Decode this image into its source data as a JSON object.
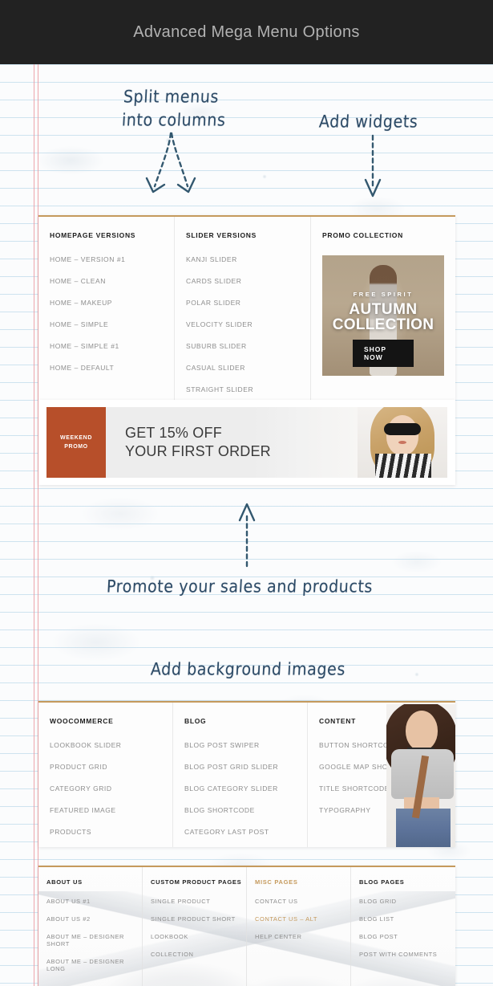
{
  "header": {
    "title": "Advanced Mega Menu Options"
  },
  "annotations": {
    "split_menus_line1": "Split menus",
    "split_menus_line2": "into columns",
    "add_widgets": "Add widgets",
    "promote_sales": "Promote your sales and products",
    "add_background": "Add background images"
  },
  "menu_panel_1": {
    "columns": [
      {
        "title": "HOMEPAGE VERSIONS",
        "items": [
          "HOME – VERSION #1",
          "HOME – CLEAN",
          "HOME – MAKEUP",
          "HOME – SIMPLE",
          "HOME – SIMPLE #1",
          "HOME – DEFAULT"
        ]
      },
      {
        "title": "SLIDER VERSIONS",
        "items": [
          "KANJI SLIDER",
          "CARDS SLIDER",
          "POLAR SLIDER",
          "VELOCITY SLIDER",
          "SUBURB SLIDER",
          "CASUAL SLIDER",
          "STRAIGHT SLIDER"
        ]
      },
      {
        "title": "PROMO COLLECTION",
        "items": []
      }
    ],
    "promo_widget": {
      "kicker": "FREE SPIRIT",
      "headline_line1": "AUTUMN",
      "headline_line2": "COLLECTION",
      "button": "SHOP NOW"
    }
  },
  "banner": {
    "tag_line1": "WEEKEND",
    "tag_line2": "PROMO",
    "headline_line1": "GET 15% OFF",
    "headline_line2": "YOUR FIRST ORDER",
    "tag_color": "#b74f2a"
  },
  "menu_panel_2": {
    "columns": [
      {
        "title": "WOOCOMMERCE",
        "items": [
          "LOOKBOOK SLIDER",
          "PRODUCT GRID",
          "CATEGORY GRID",
          "FEATURED IMAGE",
          "PRODUCTS"
        ]
      },
      {
        "title": "BLOG",
        "items": [
          "BLOG POST SWIPER",
          "BLOG POST GRID SLIDER",
          "BLOG CATEGORY SLIDER",
          "BLOG SHORTCODE",
          "CATEGORY LAST POST"
        ]
      },
      {
        "title": "CONTENT",
        "items": [
          "BUTTON SHORTCODE",
          "GOOGLE MAP SHORTCODE",
          "TITLE SHORTCODE",
          "TYPOGRAPHY"
        ]
      }
    ]
  },
  "menu_panel_3": {
    "columns": [
      {
        "title": "ABOUT US",
        "items": [
          "ABOUT US #1",
          "ABOUT US #2",
          "ABOUT ME – DESIGNER SHORT",
          "ABOUT ME – DESIGNER LONG"
        ]
      },
      {
        "title": "CUSTOM PRODUCT PAGES",
        "items": [
          "SINGLE PRODUCT",
          "SINGLE PRODUCT SHORT",
          "LOOKBOOK",
          "COLLECTION"
        ]
      },
      {
        "title": "MISC PAGES",
        "items": [
          "CONTACT US",
          "CONTACT US – ALT",
          "HELP CENTER"
        ]
      },
      {
        "title": "BLOG PAGES",
        "items": [
          "BLOG GRID",
          "BLOG LIST",
          "BLOG POST",
          "POST WITH COMMENTS"
        ]
      }
    ]
  },
  "colors": {
    "accent_gold": "#c59a5d",
    "header_bg": "#222222",
    "header_text": "#b2b2b2",
    "link_gray": "#8d8d8d",
    "handwriting_blue": "#2c4a66"
  }
}
